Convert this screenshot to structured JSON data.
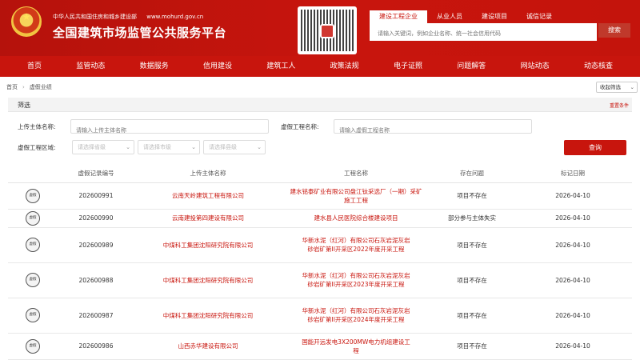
{
  "header": {
    "ministry": "中华人民共和国住房和城乡建设部",
    "url": "www.mohurd.gov.cn",
    "title": "全国建筑市场监管公共服务平台",
    "search_tabs": [
      "建设工程企业",
      "从业人员",
      "建设项目",
      "诚信记录"
    ],
    "search_placeholder": "请输入关键词，例如企业名称、统一社会信用代码",
    "search_button": "搜索"
  },
  "nav": [
    "首页",
    "监管动态",
    "数据服务",
    "信用建设",
    "建筑工人",
    "政策法规",
    "电子证照",
    "问题解答",
    "网站动态",
    "动态核查"
  ],
  "breadcrumb": {
    "home": "首页",
    "current": "虚假业绩"
  },
  "sort_label": "收起筛选",
  "filter": {
    "title": "筛选",
    "reset": "重置条件",
    "uploader_label": "上传主体名称:",
    "uploader_placeholder": "请输入上传主体名称",
    "project_label": "虚假工程名称:",
    "project_placeholder": "请输入虚假工程名称",
    "region_label": "虚假工程区域:",
    "province": "请选择省级",
    "city": "请选择市级",
    "county": "请选择县级",
    "query_button": "查询"
  },
  "table": {
    "columns": [
      "",
      "虚假记录编号",
      "上传主体名称",
      "工程名称",
      "存在问题",
      "标记日期"
    ],
    "badge_text": "虚假",
    "rows": [
      {
        "id": "202600991",
        "uploader": "云南天岭建筑工程有限公司",
        "project": "建水铭泰矿业有限公司盘江钛采选厂（一期）采矿施工工程",
        "issue": "项目不存在",
        "date": "2026-04-10"
      },
      {
        "id": "202600990",
        "uploader": "云南建投第四建设有限公司",
        "project": "建水县人民医院综合楼建设项目",
        "issue": "部分参与主体失实",
        "date": "2026-04-10"
      },
      {
        "id": "202600989",
        "uploader": "中煤科工集团沈阳研究院有限公司",
        "project": "华新水泥（红河）有限公司石灰岩泥灰岩砂岩矿第II开采区2022年度开采工程",
        "issue": "项目不存在",
        "date": "2026-04-10"
      },
      {
        "id": "202600988",
        "uploader": "中煤科工集团沈阳研究院有限公司",
        "project": "华新水泥（红河）有限公司石灰岩泥灰岩砂岩矿第II开采区2023年度开采工程",
        "issue": "项目不存在",
        "date": "2026-04-10"
      },
      {
        "id": "202600987",
        "uploader": "中煤科工集团沈阳研究院有限公司",
        "project": "华新水泥（红河）有限公司石灰岩泥灰岩砂岩矿第II开采区2024年度开采工程",
        "issue": "项目不存在",
        "date": "2026-04-10"
      },
      {
        "id": "202600986",
        "uploader": "山西赤华建设有限公司",
        "project": "国能开远发电3X200MW电力机组建设工程",
        "issue": "项目不存在",
        "date": "2026-04-10"
      }
    ]
  }
}
